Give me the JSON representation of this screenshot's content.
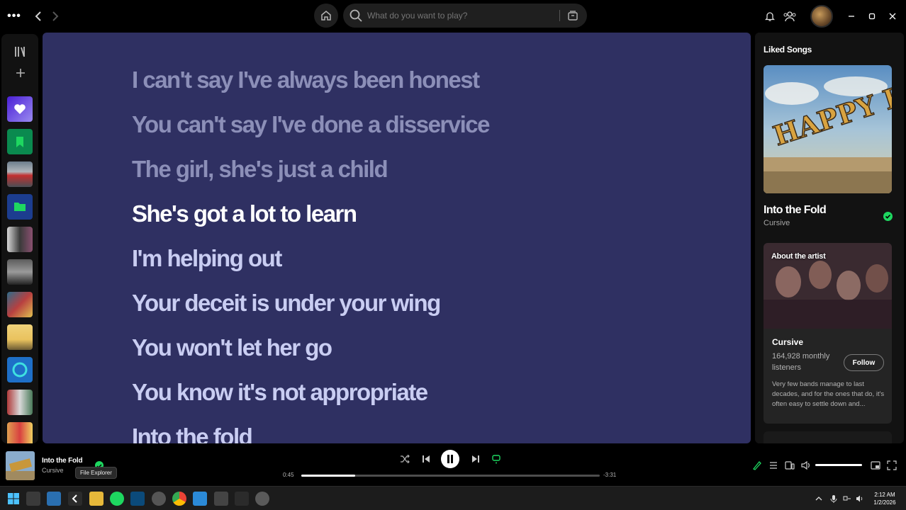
{
  "topbar": {
    "menu_label": "•••",
    "search_placeholder": "What do you want to play?"
  },
  "lyrics": {
    "lines": [
      {
        "text": "I can't say I've always been honest",
        "state": "past"
      },
      {
        "text": "You can't say I've done a disservice",
        "state": "past"
      },
      {
        "text": "The girl, she's just a child",
        "state": "past"
      },
      {
        "text": "She's got a lot to learn",
        "state": "current"
      },
      {
        "text": "I'm helping out",
        "state": "future"
      },
      {
        "text": "Your deceit is under your wing",
        "state": "future"
      },
      {
        "text": "You won't let her go",
        "state": "future"
      },
      {
        "text": "You know it's not appropriate",
        "state": "future"
      },
      {
        "text": "Into the fold",
        "state": "future"
      }
    ],
    "background_color": "#2f3062"
  },
  "right_panel": {
    "playlist_title": "Liked Songs",
    "album_art_text": "HAPPY HOLLOW",
    "song_title": "Into the Fold",
    "song_artist": "Cursive",
    "about": {
      "label": "About the artist",
      "artist_name": "Cursive",
      "monthly_listeners": "164,928 monthly listeners",
      "follow_label": "Follow",
      "bio": "Very few bands manage to last decades, and for the ones that do, it's often easy to settle down and..."
    }
  },
  "player": {
    "now_playing_title": "Into the Fold",
    "now_playing_artist": "Cursive",
    "tooltip": "File Explorer",
    "time_current": "0:45",
    "time_remaining": "-3:31",
    "progress_fraction": 0.18,
    "volume_fraction": 1.0
  },
  "taskbar": {
    "time": "2:12 AM",
    "date": "1/2/2026"
  },
  "colors": {
    "accent": "#1ed760",
    "lyrics_bg": "#2f3062",
    "lyric_past": "#8c8fb8",
    "lyric_current": "#ffffff",
    "lyric_future": "#c9cdf2"
  }
}
